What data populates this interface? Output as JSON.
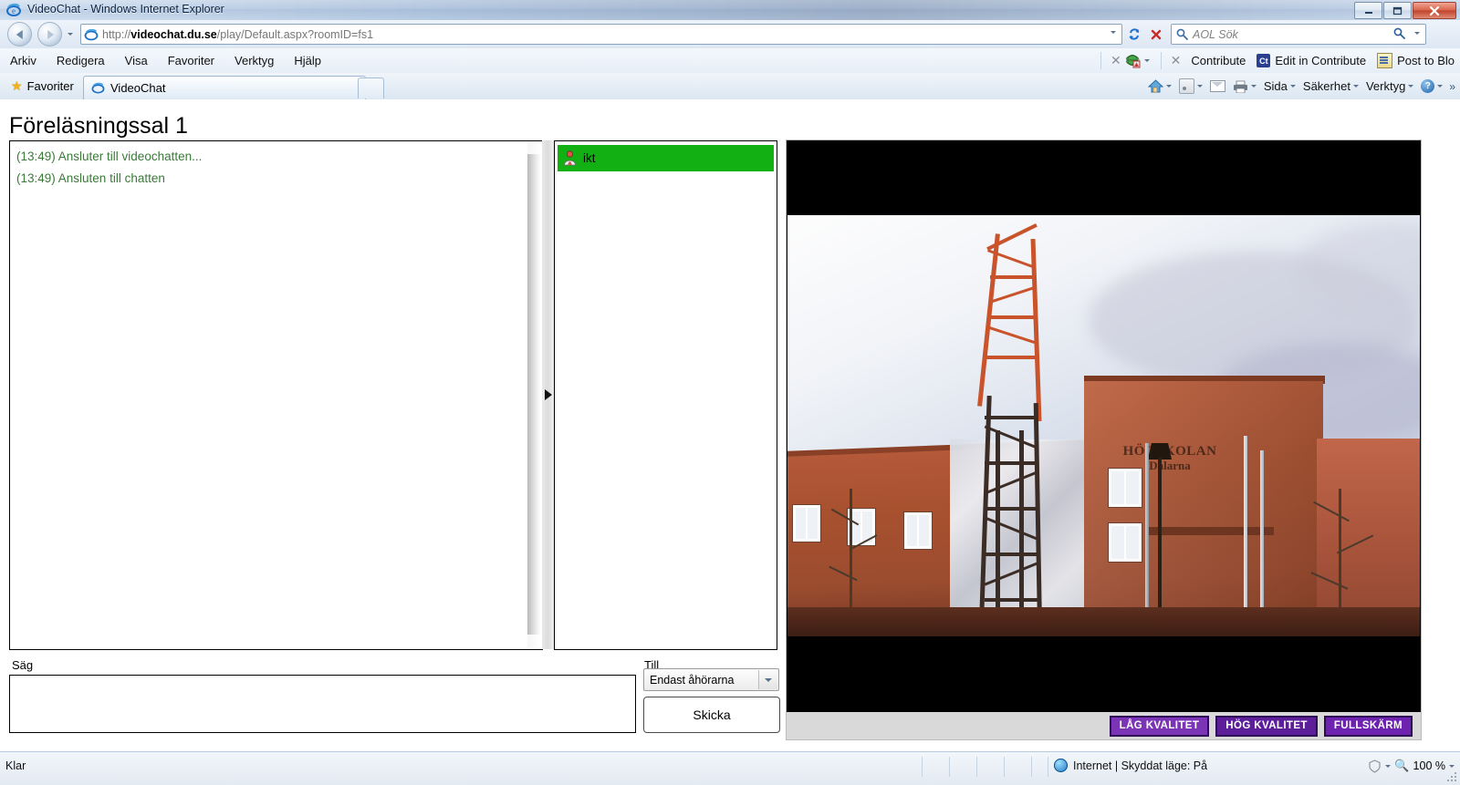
{
  "window": {
    "title": "VideoChat - Windows Internet Explorer",
    "minimize_label": "—",
    "maximize_label": "❐",
    "close_label": "✕"
  },
  "address_bar": {
    "url_scheme": "http://",
    "url_host": "videochat.du.se",
    "url_path": "/play/Default.aspx?roomID=fs1",
    "full_url": "http://videochat.du.se/play/Default.aspx?roomID=fs1",
    "back_tooltip": "Tillbaka",
    "forward_tooltip": "Framåt",
    "refresh_label": "↻",
    "stop_label": "✕",
    "search_placeholder": "AOL Sök",
    "search_value": ""
  },
  "menubar": {
    "items": [
      {
        "label": "Arkiv"
      },
      {
        "label": "Redigera"
      },
      {
        "label": "Visa"
      },
      {
        "label": "Favoriter"
      },
      {
        "label": "Verktyg"
      },
      {
        "label": "Hjälp"
      }
    ],
    "contribute": {
      "close_label": "✕",
      "toolbar_close_label": "✕",
      "contribute_label": "Contribute",
      "edit_label": "Edit in Contribute",
      "edit_badge": "Ct",
      "post_label": "Post to Blo"
    }
  },
  "tabbar": {
    "favorites_label": "Favoriter",
    "tabs": [
      {
        "label": "VideoChat",
        "active": true
      }
    ],
    "new_tab_label": ""
  },
  "commandbar": {
    "items": [
      {
        "label": "Sida"
      },
      {
        "label": "Säkerhet"
      },
      {
        "label": "Verktyg"
      }
    ],
    "help_label": "?",
    "overflow_label": "»"
  },
  "page": {
    "title": "Föreläsningssal 1",
    "chat": {
      "messages": [
        {
          "text": "(13:49) Ansluter till videochatten..."
        },
        {
          "text": "(13:49) Ansluten till chatten"
        }
      ]
    },
    "users": [
      {
        "name": "ikt",
        "selected": true
      }
    ],
    "compose": {
      "say_label": "Säg",
      "say_value": "",
      "to_label": "Till",
      "to_selected": "Endast åhörarna",
      "to_options": [
        "Endast åhörarna"
      ],
      "send_label": "Skicka"
    },
    "video": {
      "buttons": [
        {
          "label": "LÅG KVALITET"
        },
        {
          "label": "HÖG KVALITET"
        },
        {
          "label": "FULLSKÄRM"
        }
      ],
      "sign_main": "HÖGSKOLAN",
      "sign_sub": "Dalarna"
    }
  },
  "statusbar": {
    "status": "Klar",
    "zone": "Internet | Skyddat läge: På",
    "zoom": "100 %"
  },
  "colors": {
    "accent_purple": "#6d22b0",
    "user_green": "#13b013",
    "chat_green": "#3a7a38",
    "close_red": "#c0432c"
  }
}
